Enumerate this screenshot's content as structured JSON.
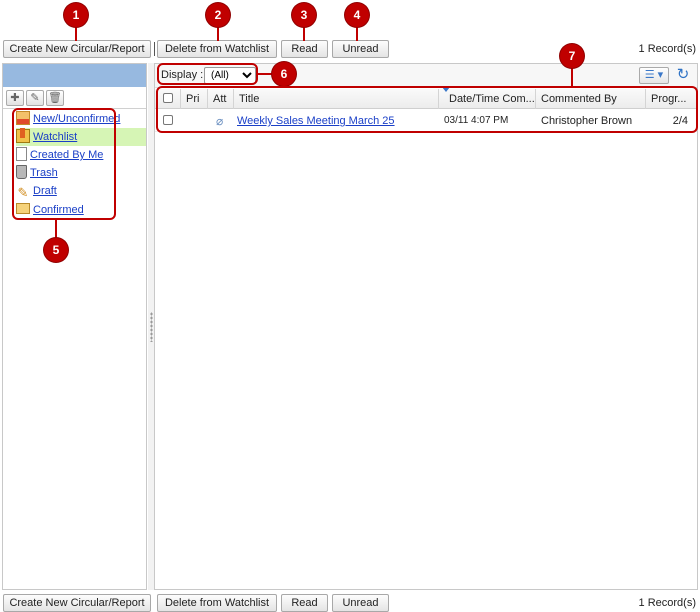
{
  "toolbar": {
    "create_label": "Create New Circular/Report",
    "delete_watchlist_label": "Delete from Watchlist",
    "read_label": "Read",
    "unread_label": "Unread",
    "records": "1 Record(s)"
  },
  "sidebar": {
    "tool_icons": [
      "add-icon",
      "edit-icon",
      "delete-icon"
    ],
    "folders": [
      {
        "label": "New/Unconfirmed",
        "icon": "new-mail-icon"
      },
      {
        "label": "Watchlist",
        "icon": "watchlist-icon"
      },
      {
        "label": "Created By Me",
        "icon": "document-icon"
      },
      {
        "label": "Trash",
        "icon": "trash-icon"
      },
      {
        "label": "Draft",
        "icon": "pencil-icon"
      },
      {
        "label": "Confirmed",
        "icon": "folder-icon"
      }
    ],
    "selected": "Watchlist"
  },
  "filter": {
    "display_label": "Display :",
    "display_value": "(All)"
  },
  "table": {
    "columns": [
      "Pri",
      "Att",
      "Title",
      "Date/Time Com...",
      "Commented By",
      "Progr..."
    ],
    "rows": [
      {
        "pri": "",
        "attachment": true,
        "title": "Weekly Sales Meeting March 25",
        "datetime": "03/11 4:07 PM",
        "commented_by": "Christopher Brown",
        "progress": "2/4"
      }
    ]
  },
  "callouts": [
    "1",
    "2",
    "3",
    "4",
    "5",
    "6",
    "7"
  ],
  "colors": {
    "callout": "#c00000",
    "selected_folder": "#d6f5b5",
    "sidebar_header": "#97b9e0",
    "link": "#1a3fc7"
  }
}
